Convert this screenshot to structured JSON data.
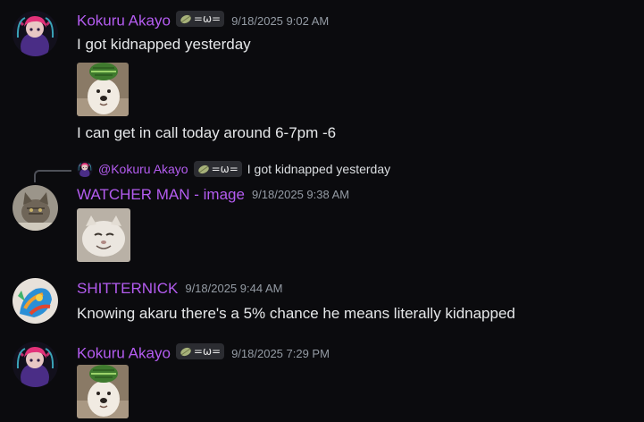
{
  "messages": [
    {
      "author": "Kokuru Akayo",
      "tag": "=ω=",
      "timestamp": "9/18/2025 9:02 AM",
      "lines": [
        "I got kidnapped yesterday",
        "I can get in call today around 6-7pm -6"
      ],
      "attachment": "dog-watermelon-hat-image"
    },
    {
      "reply": {
        "author": "@Kokuru Akayo",
        "tag": "=ω=",
        "text": "I got kidnapped yesterday"
      },
      "author": "WATCHER MAN - image",
      "timestamp": "9/18/2025 9:38 AM",
      "attachment": "smiling-cat-image"
    },
    {
      "author": "SHITTERNICK",
      "timestamp": "9/18/2025 9:44 AM",
      "lines": [
        "Knowing akaru there's a 5% chance he means literally kidnapped"
      ]
    },
    {
      "author": "Kokuru Akayo",
      "tag": "=ω=",
      "timestamp": "9/18/2025 7:29 PM",
      "attachment": "dog-watermelon-hat-image"
    }
  ],
  "colors": {
    "background": "#0b0b0e",
    "username_purple": "#b45cf0",
    "timestamp_gray": "#949ba4",
    "tag_bg": "#2b2c31"
  }
}
